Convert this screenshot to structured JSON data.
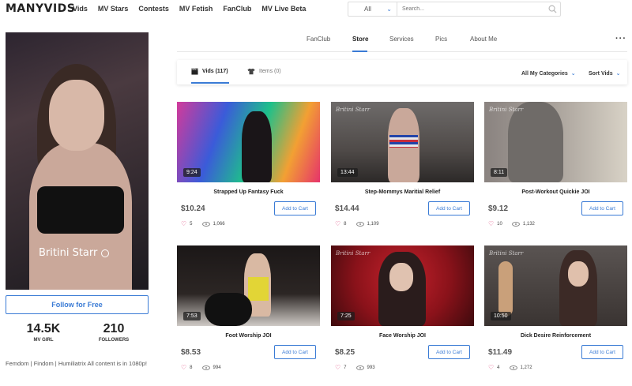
{
  "brand": {
    "logo": "MANYVIDS",
    "accent": "#3a7bd5"
  },
  "nav": {
    "links": [
      "Vids",
      "MV Stars",
      "Contests",
      "MV Fetish",
      "FanClub",
      "MV Live Beta"
    ],
    "search_scope": "All",
    "search_placeholder": "Search..."
  },
  "profile": {
    "name": "Britini Starr",
    "follow_label": "Follow for Free",
    "stats": [
      {
        "value": "14.5K",
        "label": "MV GIRL"
      },
      {
        "value": "210",
        "label": "FOLLOWERS"
      }
    ],
    "bio": "Femdom | Findom | Humiliatrix All content is in 1080p!"
  },
  "profile_tabs": [
    "FanClub",
    "Store",
    "Services",
    "Pics",
    "About Me"
  ],
  "store": {
    "tabs": [
      {
        "label": "Vids (117)",
        "icon": "clapper-icon"
      },
      {
        "label": "Items (0)",
        "icon": "shirt-icon"
      }
    ],
    "categories_label": "All My Categories",
    "sort_label": "Sort Vids"
  },
  "add_to_cart_label": "Add to Cart",
  "watermark": "Britini Starr",
  "videos": [
    {
      "title": "Strapped Up Fantasy Fuck",
      "duration": "9:24",
      "price": "$10.24",
      "likes": "5",
      "views": "1,066"
    },
    {
      "title": "Step-Mommys Maritial Relief",
      "duration": "13:44",
      "price": "$14.44",
      "likes": "8",
      "views": "1,109"
    },
    {
      "title": "Post-Workout Quickie JOI",
      "duration": "8:11",
      "price": "$9.12",
      "likes": "10",
      "views": "1,132"
    },
    {
      "title": "Foot Worship JOI",
      "duration": "7:53",
      "price": "$8.53",
      "likes": "8",
      "views": "994"
    },
    {
      "title": "Face Worship JOI",
      "duration": "7:25",
      "price": "$8.25",
      "likes": "7",
      "views": "993"
    },
    {
      "title": "Dick Desire Reinforcement",
      "duration": "10:50",
      "price": "$11.49",
      "likes": "4",
      "views": "1,272"
    }
  ]
}
